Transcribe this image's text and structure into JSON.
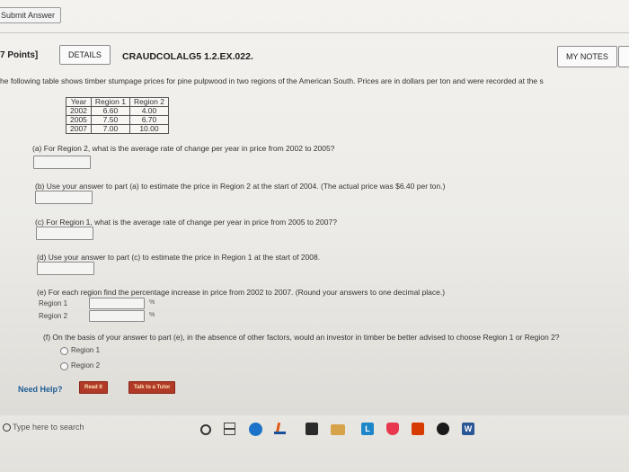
{
  "header": {
    "submit_label": "Submit Answer",
    "points": "7 Points]",
    "details_label": "DETAILS",
    "question_code": "CRAUDCOLALG5 1.2.EX.022.",
    "my_notes_label": "MY NOTES"
  },
  "intro": "he following table shows timber stumpage prices for pine pulpwood in two regions of the American South. Prices are in dollars per ton and were recorded at the s",
  "table": {
    "headers": [
      "Year",
      "Region 1",
      "Region 2"
    ],
    "rows": [
      [
        "2002",
        "6.60",
        "4.00"
      ],
      [
        "2005",
        "7.50",
        "6.70"
      ],
      [
        "2007",
        "7.00",
        "10.00"
      ]
    ]
  },
  "questions": {
    "a": "(a) For Region 2, what is the average rate of change per year in price from 2002 to 2005?",
    "b": "(b) Use your answer to part (a) to estimate the price in Region 2 at the start of 2004. (The actual price was $6.40 per ton.)",
    "c": "(c) For Region 1, what is the average rate of change per year in price from 2005 to 2007?",
    "d": "(d) Use your answer to part (c) to estimate the price in Region 1 at the start of 2008.",
    "e": "(e) For each region find the percentage increase in price from 2002 to 2007. (Round your answers to one decimal place.)",
    "e_region1": "Region 1",
    "e_region2": "Region 2",
    "percent": "%",
    "f": "(f) On the basis of your answer to part (e), in the absence of other factors, would an investor in timber be better advised to choose Region 1 or Region 2?",
    "f_option1": "Region 1",
    "f_option2": "Region 2"
  },
  "help": {
    "label": "Need Help?",
    "read_it": "Read It",
    "talk_to_tutor": "Talk to a Tutor"
  },
  "taskbar": {
    "search_placeholder": "Type here to search",
    "icons": [
      "search-icon",
      "cortana-icon",
      "task-view-icon",
      "edge-icon",
      "java-icon",
      "store-icon",
      "file-explorer-icon",
      "l-app-icon",
      "pocket-icon",
      "office-icon",
      "music-icon",
      "word-icon"
    ]
  },
  "colors": {
    "need_help": "#1e5d94",
    "help_button": "#b13a26",
    "edge": "#1a73c8",
    "word": "#2b5797"
  }
}
